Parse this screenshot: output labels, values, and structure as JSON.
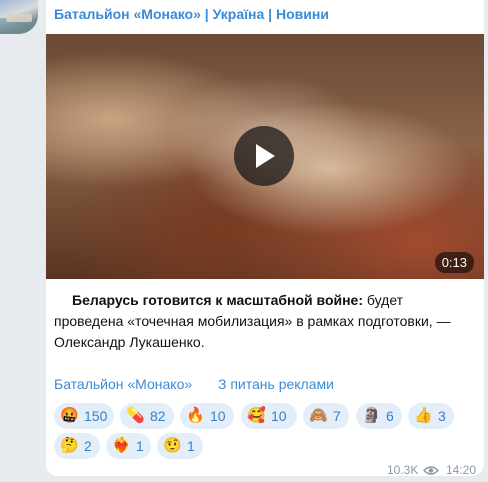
{
  "channel": {
    "name": "Батальйон «Монако» | Україна | Новини"
  },
  "video": {
    "duration": "0:13"
  },
  "post": {
    "bold": "Беларусь готовится к масштабной войне:",
    "rest": " будет проведена «точечная мобилизация» в рамках подготовки, — Олександр Лукашенко."
  },
  "links": {
    "channel": "Батальйон «Монако»",
    "ads": "З питань реклами"
  },
  "reactions": [
    {
      "icon": "angry-face-icon",
      "emoji": "🤬",
      "count": "150"
    },
    {
      "icon": "pill-icon",
      "emoji": "💊",
      "count": "82"
    },
    {
      "icon": "fire-icon",
      "emoji": "🔥",
      "count": "10"
    },
    {
      "icon": "smiling-hearts-icon",
      "emoji": "🥰",
      "count": "10"
    },
    {
      "icon": "see-no-evil-monkey-icon",
      "emoji": "🙈",
      "count": "7"
    },
    {
      "icon": "moai-icon",
      "emoji": "🗿",
      "count": "6"
    },
    {
      "icon": "thumbs-up-icon",
      "emoji": "👍",
      "count": "3"
    },
    {
      "icon": "thinking-face-icon",
      "emoji": "🤔",
      "count": "2"
    },
    {
      "icon": "heart-on-fire-icon",
      "emoji": "❤‍🔥",
      "count": "1"
    },
    {
      "icon": "face-with-raised-eyebrow-icon",
      "emoji": "🤨",
      "count": "1"
    }
  ],
  "meta": {
    "views": "10.3K",
    "time": "14:20"
  },
  "colors": {
    "accent": "#3a8bd6",
    "reaction_bg": "#e4eef8",
    "chat_bg": "#e7ebf0"
  }
}
